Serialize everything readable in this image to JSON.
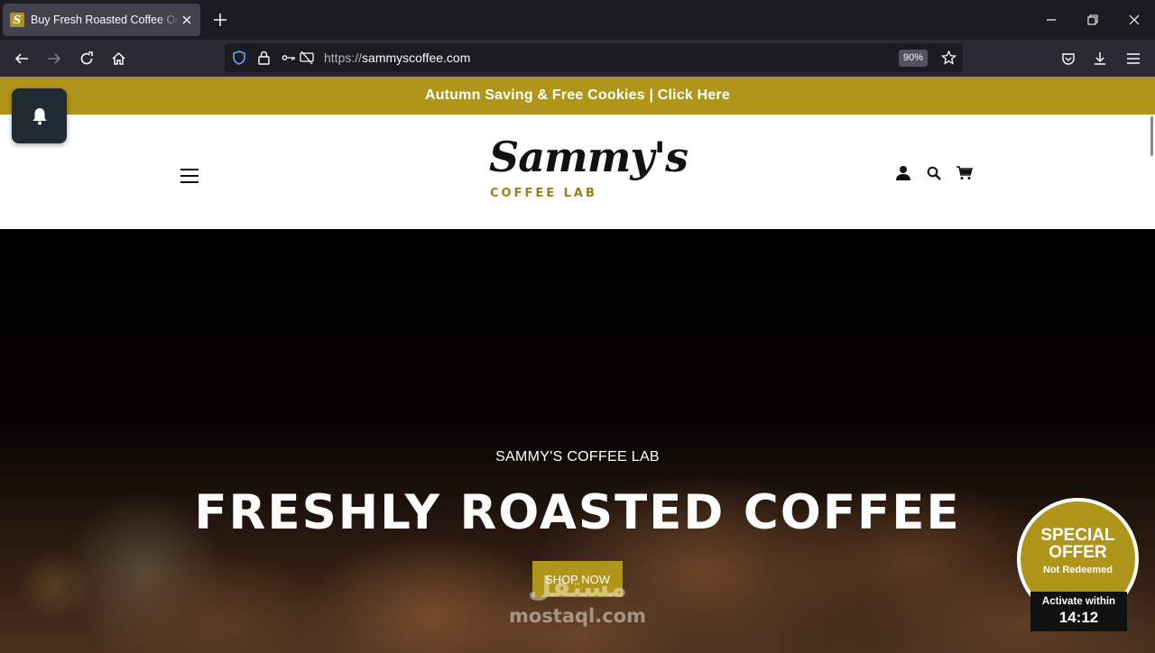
{
  "browser": {
    "tab": {
      "title": "Buy Fresh Roasted Coffee Online",
      "favicon_letter": "S"
    },
    "url": {
      "protocol": "https://",
      "host": "sammyscoffee.com"
    },
    "zoom": "90%"
  },
  "announcement": {
    "text": "Autumn Saving & Free Cookies | Click Here"
  },
  "header": {
    "logo_script": "Sammy's",
    "logo_sub": "COFFEE LAB"
  },
  "hero": {
    "kicker": "SAMMY'S COFFEE LAB",
    "title": "FRESHLY ROASTED COFFEE",
    "cta": "SHOP NOW"
  },
  "watermark": {
    "arabic": "مستقل",
    "latin": "mostaql.com"
  },
  "offer": {
    "title": "SPECIAL OFFER",
    "status": "Not Redeemed",
    "timer_label": "Activate within",
    "timer_value": "14:12"
  },
  "colors": {
    "brand_gold": "#b0951b",
    "browser_tabbar": "#1c1b22",
    "browser_toolbar": "#2b2a33"
  }
}
